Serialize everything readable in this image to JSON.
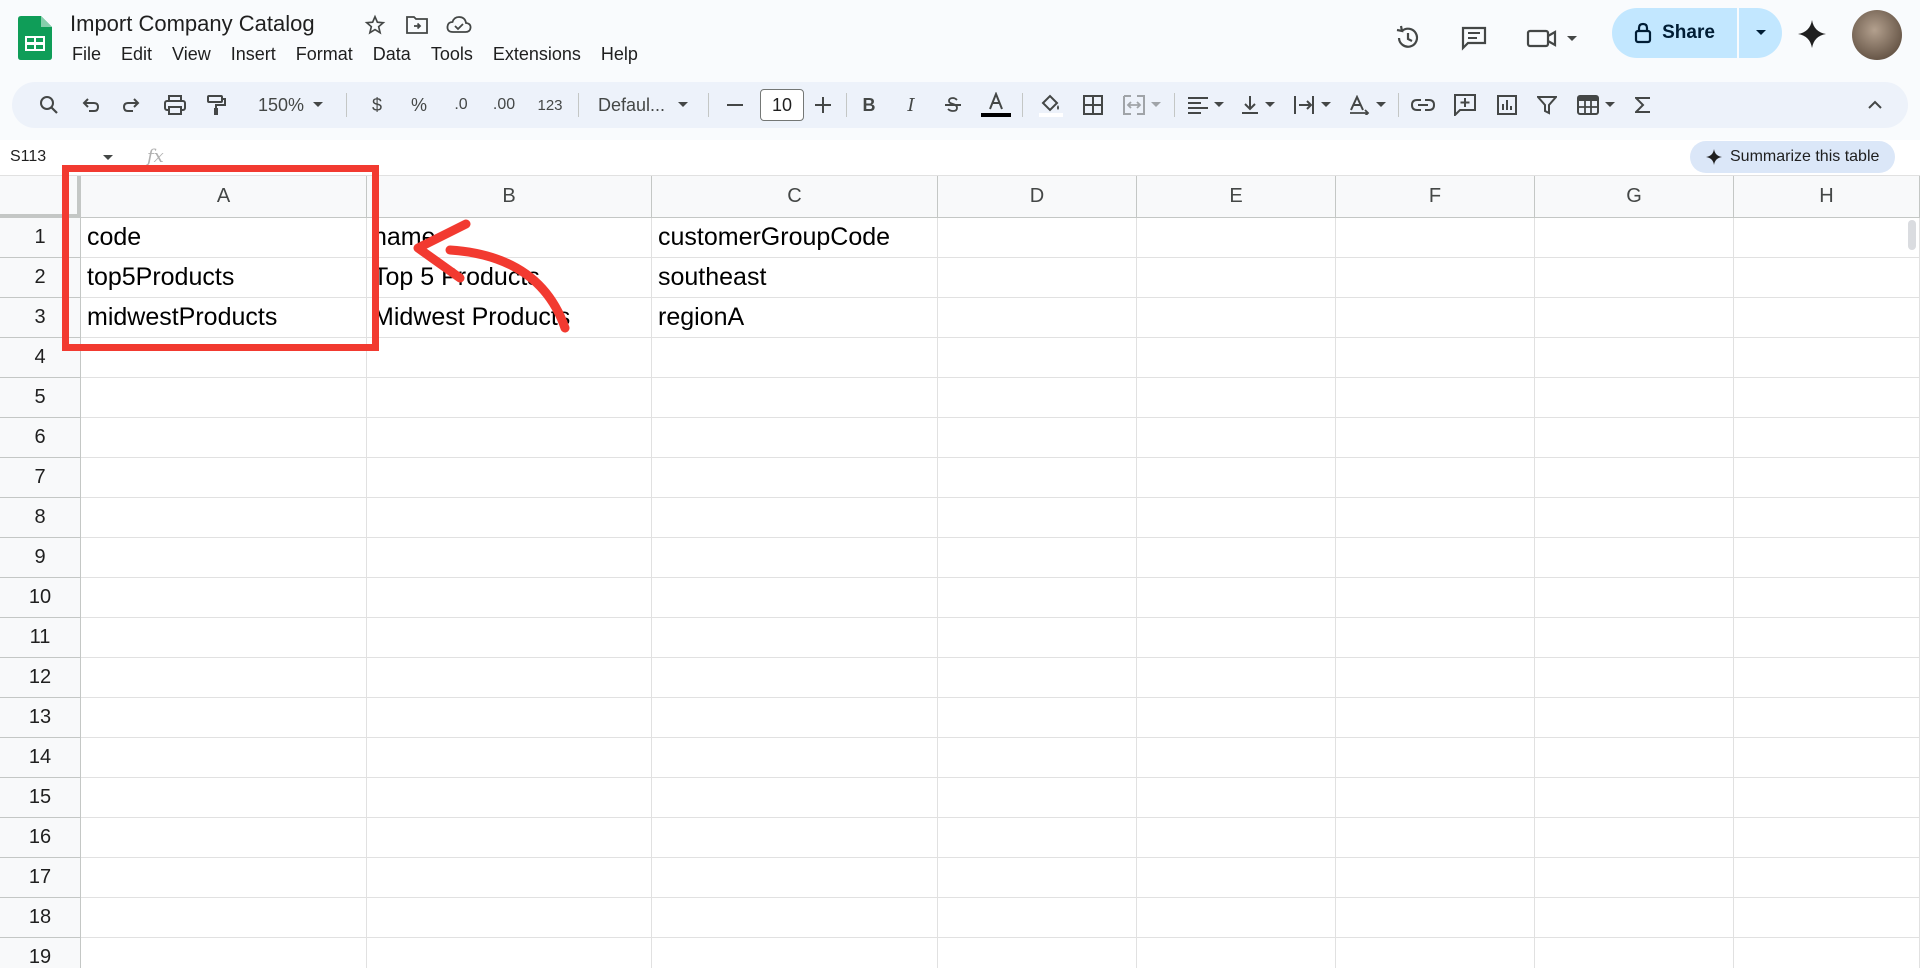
{
  "doc": {
    "title": "Import Company Catalog"
  },
  "menu": [
    "File",
    "Edit",
    "View",
    "Insert",
    "Format",
    "Data",
    "Tools",
    "Extensions",
    "Help"
  ],
  "header_actions": {
    "share_label": "Share"
  },
  "toolbar": {
    "zoom": "150%",
    "currency": "$",
    "percent": "%",
    "dec_decrease": ".0",
    "dec_increase": ".00",
    "number_format": "123",
    "font": "Defaul...",
    "font_size": "10",
    "bold": "B",
    "italic": "I"
  },
  "formula_bar": {
    "cell_ref": "S113",
    "fx": "fx",
    "summarize_label": "Summarize this table"
  },
  "sheet": {
    "columns": [
      "A",
      "B",
      "C",
      "D",
      "E",
      "F",
      "G",
      "H"
    ],
    "rows": [
      "1",
      "2",
      "3",
      "4",
      "5",
      "6",
      "7",
      "8",
      "9",
      "10",
      "11",
      "12",
      "13",
      "14",
      "15",
      "16",
      "17",
      "18",
      "19"
    ],
    "cells": [
      [
        "code",
        "name",
        "customerGroupCode"
      ],
      [
        "top5Products",
        "Top 5 Products",
        "southeast"
      ],
      [
        "midwestProducts",
        "Midwest Products",
        "regionA"
      ]
    ]
  },
  "colors": {
    "accent": "#c2e7ff",
    "annotation": "#f23a30",
    "sheets_green": "#0f9d58"
  }
}
